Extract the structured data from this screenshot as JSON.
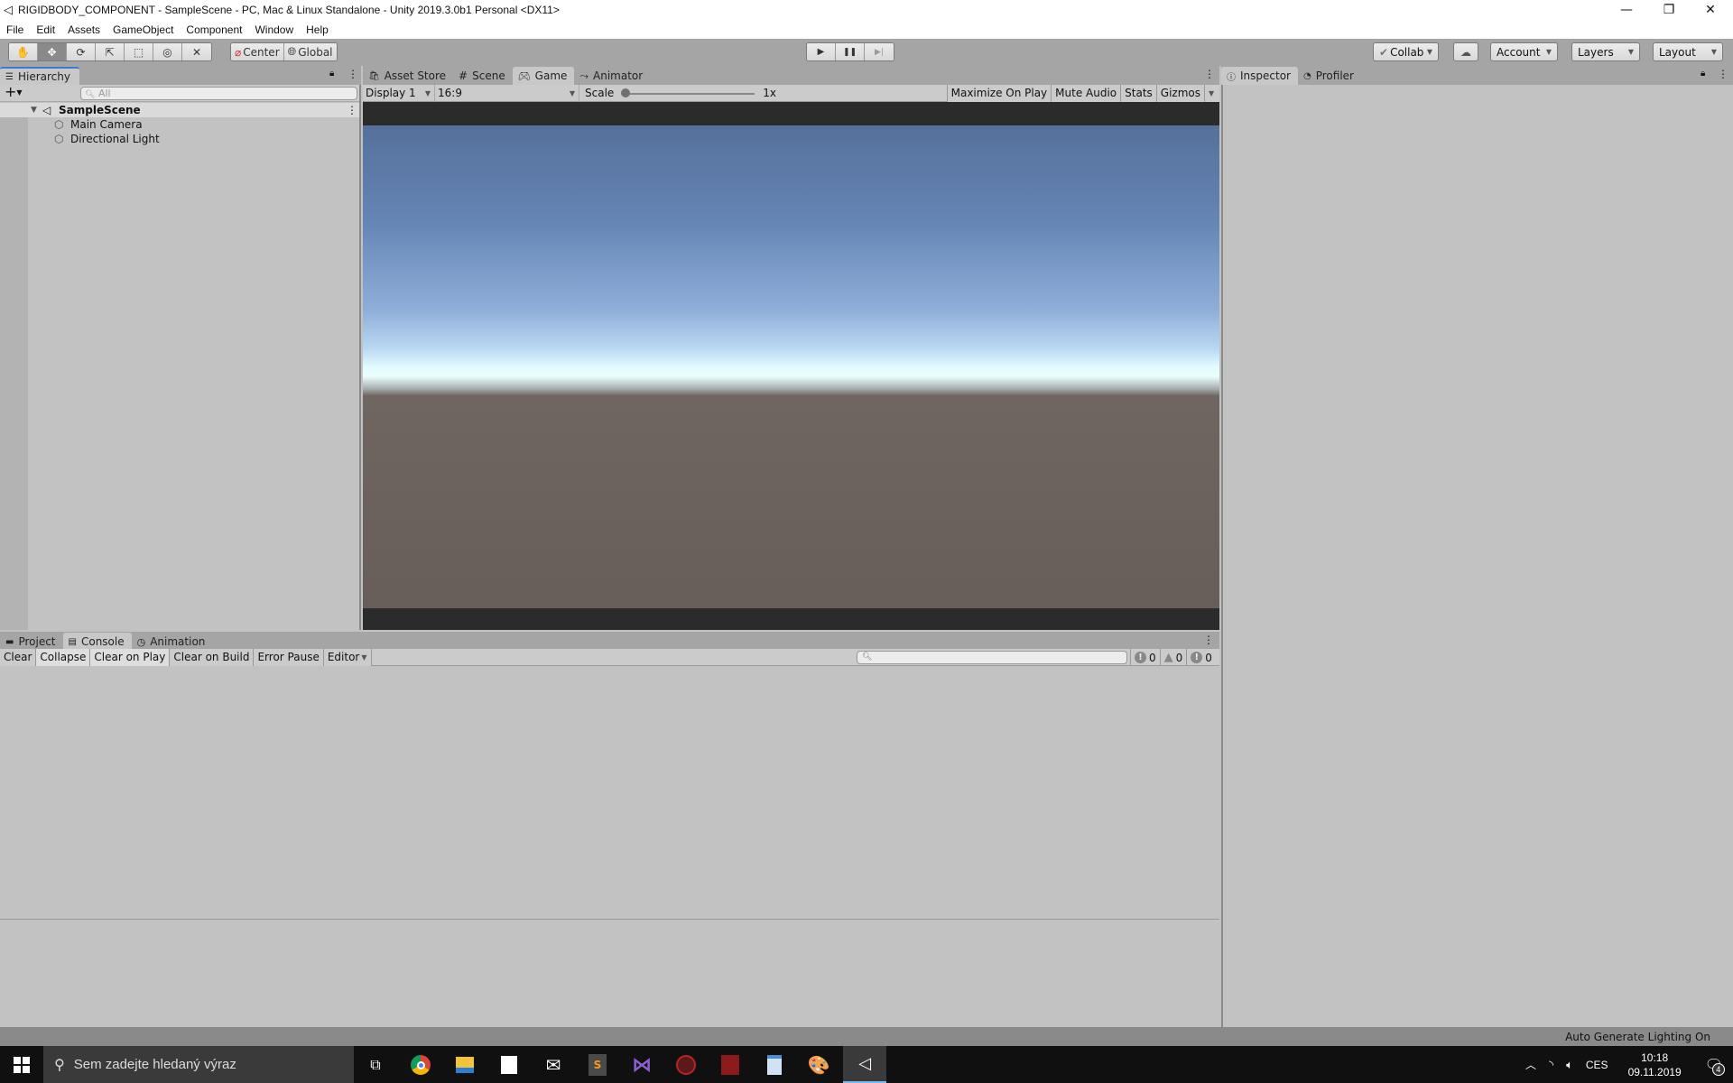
{
  "window": {
    "title": "RIGIDBODY_COMPONENT - SampleScene - PC, Mac & Linux Standalone - Unity 2019.3.0b1 Personal <DX11>",
    "minimize": "—",
    "restore": "❐",
    "close": "✕"
  },
  "menu": [
    "File",
    "Edit",
    "Assets",
    "GameObject",
    "Component",
    "Window",
    "Help"
  ],
  "toolbar": {
    "tools": [
      {
        "name": "hand-tool",
        "icon": "✋",
        "active": false
      },
      {
        "name": "move-tool",
        "icon": "✥",
        "active": true
      },
      {
        "name": "rotate-tool",
        "icon": "⟳",
        "active": false
      },
      {
        "name": "scale-tool",
        "icon": "⇱",
        "active": false
      },
      {
        "name": "rect-tool",
        "icon": "⬚",
        "active": false
      },
      {
        "name": "transform-tool",
        "icon": "◎",
        "active": false
      },
      {
        "name": "custom-tool",
        "icon": "✕",
        "active": false
      }
    ],
    "pivot_center": "Center",
    "pivot_global": "Global",
    "play_icon": "▶",
    "pause_icon": "❚❚",
    "step_icon": "▶|",
    "collab": "Collab",
    "cloud_icon": "☁",
    "account": "Account",
    "layers": "Layers",
    "layout": "Layout"
  },
  "hierarchy": {
    "tab": "Hierarchy",
    "add_icon": "+",
    "search_placeholder": "All",
    "scene": "SampleScene",
    "items": [
      "Main Camera",
      "Directional Light"
    ]
  },
  "center_tabs": [
    {
      "label": "Asset Store",
      "icon": "🔒",
      "active": false
    },
    {
      "label": "Scene",
      "icon": "#",
      "active": false
    },
    {
      "label": "Game",
      "icon": "🎮",
      "active": true
    },
    {
      "label": "Animator",
      "icon": "⤳",
      "active": false
    }
  ],
  "game": {
    "display": "Display 1",
    "aspect": "16:9",
    "scale_label": "Scale",
    "scale_value": "1x",
    "scale_level": 0,
    "maximize_on_play": "Maximize On Play",
    "mute_audio": "Mute Audio",
    "stats": "Stats",
    "gizmos": "Gizmos"
  },
  "right_tabs": [
    {
      "label": "Inspector",
      "active": true
    },
    {
      "label": "Profiler",
      "active": false
    }
  ],
  "bottom_tabs": [
    {
      "label": "Project",
      "active": false
    },
    {
      "label": "Console",
      "active": true
    },
    {
      "label": "Animation",
      "active": false
    }
  ],
  "console": {
    "buttons": [
      "Clear",
      "Collapse",
      "Clear on Play",
      "Clear on Build",
      "Error Pause",
      "Editor"
    ],
    "search_placeholder": "",
    "info_count": "0",
    "warning_count": "0",
    "error_count": "0"
  },
  "status": {
    "message": "Auto Generate Lighting On"
  },
  "taskbar": {
    "search_placeholder": "Sem zadejte hledaný výraz",
    "apps": [
      "task-view",
      "chrome",
      "file-explorer",
      "store",
      "mail",
      "sublime-text",
      "visual-studio",
      "gpu-tweak-1",
      "gpu-tweak-2",
      "notepad",
      "paint",
      "unity"
    ],
    "language": "CES",
    "time": "10:18",
    "date": "09.11.2019",
    "notifications": "4"
  }
}
